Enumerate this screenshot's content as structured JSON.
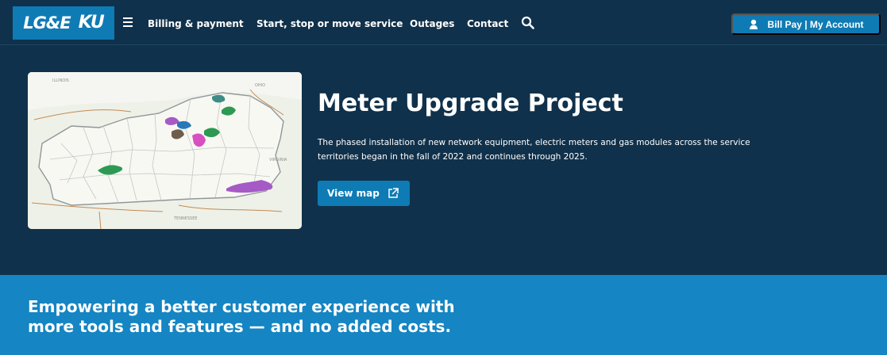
{
  "brand": {
    "logo_text_1": "LG&E",
    "logo_text_2": "KU",
    "primary_color": "#10314b",
    "accent_color": "#0f7bb4",
    "promo_color": "#1585c3"
  },
  "header": {
    "menu_icon": "menu-icon",
    "nav_items": [
      {
        "label": "Billing & payment"
      },
      {
        "label": "Start, stop or move service"
      },
      {
        "label": "Outages"
      },
      {
        "label": "Contact"
      }
    ],
    "search_icon": "search-icon",
    "account_button": {
      "label": "Bill Pay | My Account",
      "icon": "user-icon"
    }
  },
  "hero": {
    "title": "Meter Upgrade Project",
    "description": "The phased installation of new network equipment, electric meters and gas modules across the service territories began in the fall of 2022 and continues through 2025.",
    "button_label": "View map",
    "button_icon": "external-link-icon"
  },
  "promo": {
    "headline_line_1": "Empowering a better customer experience with",
    "headline_line_2": "more tools and features — and no added costs."
  }
}
